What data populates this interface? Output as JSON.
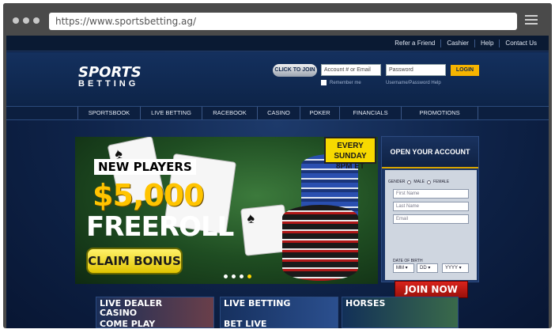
{
  "browser": {
    "url": "https://www.sportsbetting.ag/"
  },
  "top_links": [
    "Refer a Friend",
    "Cashier",
    "Help",
    "Contact Us"
  ],
  "logo": {
    "line1": "SPORTS",
    "line2": "BETTING"
  },
  "login": {
    "click_to_join": "CLICK TO JOIN",
    "account_placeholder": "Account # or Email",
    "password_placeholder": "Password",
    "login_button": "LOGIN",
    "remember_me": "Remember me",
    "forgot": "Username/Password Help"
  },
  "nav": [
    "SPORTSBOOK",
    "LIVE BETTING",
    "RACEBOOK",
    "CASINO",
    "POKER",
    "FINANCIALS",
    "PROMOTIONS"
  ],
  "hero": {
    "badge": "NEW PLAYERS",
    "amount": "$5,000",
    "headline": "FREEROLL",
    "cta": "CLAIM BONUS",
    "schedule_line1": "EVERY SUNDAY",
    "schedule_line2": "8PM ET",
    "slides": 4,
    "active_slide": 4
  },
  "account": {
    "title": "OPEN YOUR ACCOUNT",
    "gender_label": "GENDER",
    "male": "MALE",
    "female": "FEMALE",
    "first_name_placeholder": "First Name",
    "last_name_placeholder": "Last Name",
    "email_placeholder": "Email",
    "dob_label": "DATE OF BIRTH",
    "month": "MM",
    "day": "DD",
    "year": "YYYY",
    "join_button": "JOIN NOW"
  },
  "promos": [
    {
      "line1": "LIVE DEALER",
      "line2": "CASINO",
      "line3": "COME PLAY"
    },
    {
      "line1": "LIVE BETTING",
      "line2": "",
      "line3": "BET LIVE"
    },
    {
      "line1": "HORSES",
      "line2": "",
      "line3": ""
    }
  ]
}
